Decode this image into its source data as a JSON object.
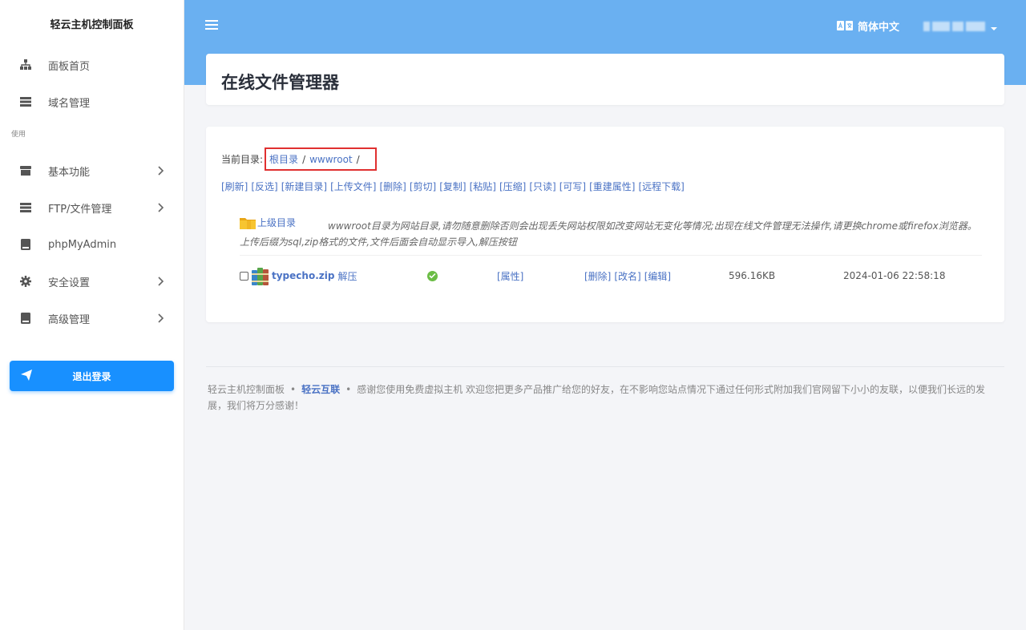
{
  "sidebar": {
    "brand": "轻云主机控制面板",
    "top_items": [
      {
        "label": "面板首页",
        "icon": "sitemap-icon"
      },
      {
        "label": "域名管理",
        "icon": "server-icon"
      }
    ],
    "section_label": "使用",
    "items": [
      {
        "label": "基本功能",
        "icon": "store-icon"
      },
      {
        "label": "FTP/文件管理",
        "icon": "server-icon"
      },
      {
        "label": "phpMyAdmin",
        "icon": "book-icon"
      },
      {
        "label": "安全设置",
        "icon": "gear-icon"
      },
      {
        "label": "高级管理",
        "icon": "book-icon"
      }
    ],
    "logout_label": "退出登录"
  },
  "header": {
    "language": "简体中文"
  },
  "page": {
    "title": "在线文件管理器",
    "current_dir_label": "当前目录:",
    "breadcrumb": [
      "根目录",
      "wwwroot"
    ],
    "breadcrumb_sep": "/",
    "actions": [
      "[刷新]",
      "[反选]",
      "[新建目录]",
      "[上传文件]",
      "[删除]",
      "[剪切]",
      "[复制]",
      "[粘贴]",
      "[压缩]",
      "[只读]",
      "[可写]",
      "[重建属性]",
      "[远程下载]"
    ],
    "parent_dir_label": "上级目录",
    "notice": "wwwroot目录为网站目录,请勿随意删除否则会出现丢失网站权限如改变网站无变化等情况;出现在线文件管理无法操作,请更换chrome或firefox浏览器。上传后缀为sql,zip格式的文件,文件后面会自动显示导入,解压按钮",
    "files": [
      {
        "name": "typecho.zip",
        "extra_action": "解压",
        "attr_label": "[属性]",
        "ops": [
          "[删除]",
          "[改名]",
          "[编辑]"
        ],
        "size": "596.16KB",
        "modified": "2024-01-06 22:58:18"
      }
    ]
  },
  "footer": {
    "brand": "轻云主机控制面板",
    "link": "轻云互联",
    "text": "感谢您使用免费虚拟主机 欢迎您把更多产品推广给您的好友，在不影响您站点情况下通过任何形式附加我们官网留下小小的友联，以便我们长远的发展，我们将万分感谢！"
  },
  "colors": {
    "header_bg": "#6ab0f1",
    "accent": "#1890ff",
    "link": "#4a72c4",
    "highlight_border": "#e03030",
    "status_ok": "#6bbd45"
  }
}
